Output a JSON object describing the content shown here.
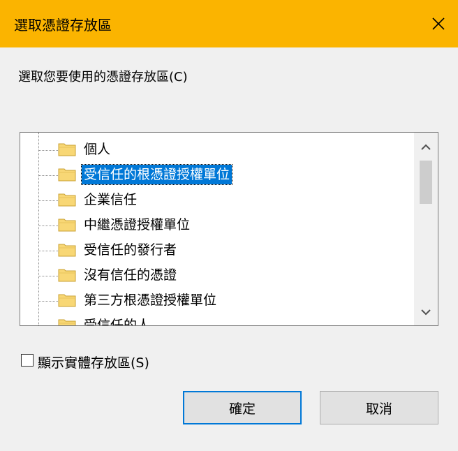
{
  "window": {
    "title": "選取憑證存放區"
  },
  "prompt": {
    "text": "選取您要使用的憑證存放區(C)"
  },
  "stores": [
    {
      "label": "個人",
      "selected": false
    },
    {
      "label": "受信任的根憑證授權單位",
      "selected": true
    },
    {
      "label": "企業信任",
      "selected": false
    },
    {
      "label": "中繼憑證授權單位",
      "selected": false
    },
    {
      "label": "受信任的發行者",
      "selected": false
    },
    {
      "label": "沒有信任的憑證",
      "selected": false
    },
    {
      "label": "第三方根憑證授權單位",
      "selected": false
    },
    {
      "label": "受信任的人",
      "selected": false
    }
  ],
  "show_physical": {
    "label": "顯示實體存放區(S)",
    "checked": false
  },
  "buttons": {
    "ok": "確定",
    "cancel": "取消"
  },
  "colors": {
    "titlebar": "#fbb400",
    "selection": "#0078d7",
    "folder": "#f8d775"
  }
}
